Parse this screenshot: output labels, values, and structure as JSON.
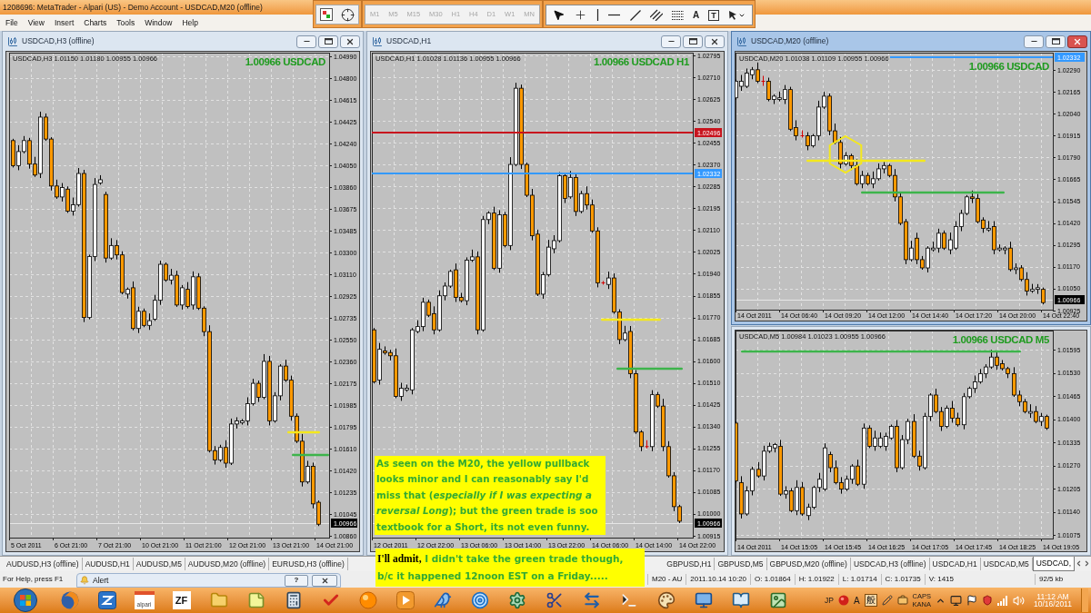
{
  "window": {
    "title": "1208696: MetaTrader - Alpari (US) - Demo Account - USDCAD,M20 (offline)"
  },
  "menu": [
    "File",
    "View",
    "Insert",
    "Charts",
    "Tools",
    "Window",
    "Help"
  ],
  "toolbar": {
    "periods": [
      {
        "label": "M1",
        "disabled": true
      },
      {
        "label": "M5",
        "disabled": true
      },
      {
        "label": "M15",
        "disabled": true
      },
      {
        "label": "M30",
        "disabled": true
      },
      {
        "label": "H1",
        "disabled": true
      },
      {
        "label": "H4",
        "disabled": true
      },
      {
        "label": "D1",
        "disabled": true
      },
      {
        "label": "W1",
        "disabled": true
      },
      {
        "label": "MN",
        "disabled": true
      }
    ],
    "text_tool": "A",
    "label_tool": "T"
  },
  "charts": [
    {
      "title": "USDCAD,H3 (offline)",
      "selected": false,
      "info": "USDCAD,H3  1.01150 1.01180 1.00955 1.00966",
      "badge": "1.00966 USDCAD",
      "price_ticks": [
        "1.04990",
        "1.04800",
        "1.04615",
        "1.04425",
        "1.04240",
        "1.04050",
        "1.03860",
        "1.03675",
        "1.03485",
        "1.03300",
        "1.03110",
        "1.02925",
        "1.02735",
        "1.02550",
        "1.02360",
        "1.02175",
        "1.01985",
        "1.01795",
        "1.01610",
        "1.01420",
        "1.01235",
        "1.01045",
        "1.00860"
      ],
      "current_price": "1.00966",
      "time_ticks": [
        "5 Oct 2011",
        "6 Oct 21:00",
        "7 Oct 21:00",
        "10 Oct 21:00",
        "11 Oct 21:00",
        "12 Oct 21:00",
        "13 Oct 21:00",
        "14 Oct 21:00"
      ]
    },
    {
      "title": "USDCAD,H1",
      "selected": false,
      "info": "USDCAD,H1  1.01028 1.01136 1.00955 1.00966",
      "badge": "1.00966 USDCAD H1",
      "price_ticks": [
        "1.02795",
        "1.02710",
        "1.02625",
        "1.02540",
        "1.02455",
        "1.02370",
        "1.02285",
        "1.02195",
        "1.02110",
        "1.02025",
        "1.01940",
        "1.01855",
        "1.01770",
        "1.01685",
        "1.01600",
        "1.01510",
        "1.01425",
        "1.01340",
        "1.01255",
        "1.01170",
        "1.01085",
        "1.01000",
        "1.00915"
      ],
      "price_lines": [
        {
          "label": "1.02496",
          "color": "#c8141e"
        },
        {
          "label": "1.02332",
          "color": "#3399ff"
        }
      ],
      "current_price": "1.00966",
      "time_ticks": [
        "12 Oct 2011",
        "12 Oct 22:00",
        "13 Oct 06:00",
        "13 Oct 14:00",
        "13 Oct 22:00",
        "14 Oct 06:00",
        "14 Oct 14:00",
        "14 Oct 22:00"
      ],
      "note": "As seen on the M20, the yellow pullback looks minor and I can reasonably say I'd miss that (*especially if I was expecting a reversal Long*); but the green trade is soo textbook for a Short, its not even funny."
    },
    {
      "title": "USDCAD,M20 (offline)",
      "selected": true,
      "info": "USDCAD,M20  1.01038 1.01109 1.00955 1.00966",
      "badge": "1.00966 USDCAD",
      "price_ticks": [
        "1.02290",
        "1.02165",
        "1.02040",
        "1.01915",
        "1.01790",
        "1.01665",
        "1.01545",
        "1.01420",
        "1.01295",
        "1.01170",
        "1.01050",
        "1.00925"
      ],
      "price_lines": [
        {
          "label": "1.02332",
          "color": "#3399ff"
        }
      ],
      "current_price": "1.00966",
      "time_ticks": [
        "14 Oct 2011",
        "14 Oct 06:40",
        "14 Oct 09:20",
        "14 Oct 12:00",
        "14 Oct 14:40",
        "14 Oct 17:20",
        "14 Oct 20:00",
        "14 Oct 22:40"
      ]
    },
    {
      "selected": false,
      "info": "USDCAD,M5  1.00984 1.01023 1.00955 1.00966",
      "badge": "1.00966 USDCAD M5",
      "price_ticks": [
        "1.01595",
        "1.01530",
        "1.01465",
        "1.01400",
        "1.01335",
        "1.01270",
        "1.01205",
        "1.01140",
        "1.01075"
      ],
      "time_ticks": [
        "14 Oct 2011",
        "14 Oct 15:05",
        "14 Oct 15:45",
        "14 Oct 16:25",
        "14 Oct 17:05",
        "14 Oct 17:45",
        "14 Oct 18:25",
        "14 Oct 19:05"
      ]
    }
  ],
  "chart_tabs": {
    "left_group": [
      {
        "label": "AUDUSD,H3 (offline)",
        "selected": false
      },
      {
        "label": "AUDUSD,H1",
        "selected": false
      },
      {
        "label": "AUDUSD,M5",
        "selected": false
      },
      {
        "label": "AUDUSD,M20 (offline)",
        "selected": false
      },
      {
        "label": "EURUSD,H3 (offline)",
        "selected": false
      }
    ],
    "right_group": [
      {
        "label": "GBPUSD,H1",
        "selected": false
      },
      {
        "label": "GBPUSD,M5",
        "selected": false
      },
      {
        "label": "GBPUSD,M20 (offline)",
        "selected": false
      },
      {
        "label": "USDCAD,H3 (offline)",
        "selected": false
      },
      {
        "label": "USDCAD,H1",
        "selected": false
      },
      {
        "label": "USDCAD,M5",
        "selected": false
      },
      {
        "label": "USDCAD,",
        "selected": true
      }
    ]
  },
  "status_bar": {
    "help": "For Help, press F1",
    "fields": [
      "M20 - AU",
      "2011.10.14 10:20",
      "O: 1.01864",
      "H: 1.01922",
      "L: 1.01714",
      "C: 1.01735",
      "V: 1415",
      "92/5 kb"
    ]
  },
  "alert": {
    "title": "Alert",
    "help_button": "?"
  },
  "annotation": {
    "lead": "I'll admit,",
    "text": "I didn't take the green trade though, b/c it happened 12noon EST on a Friday....."
  },
  "taskbar": {
    "app_labels": [
      "alpari",
      "ZF"
    ],
    "tray": {
      "language": "JP",
      "ime": [
        "A",
        "般"
      ],
      "keys": [
        "CAPS",
        "KANA"
      ],
      "time": "11:12 AM",
      "date": "10/16/2011"
    }
  }
}
